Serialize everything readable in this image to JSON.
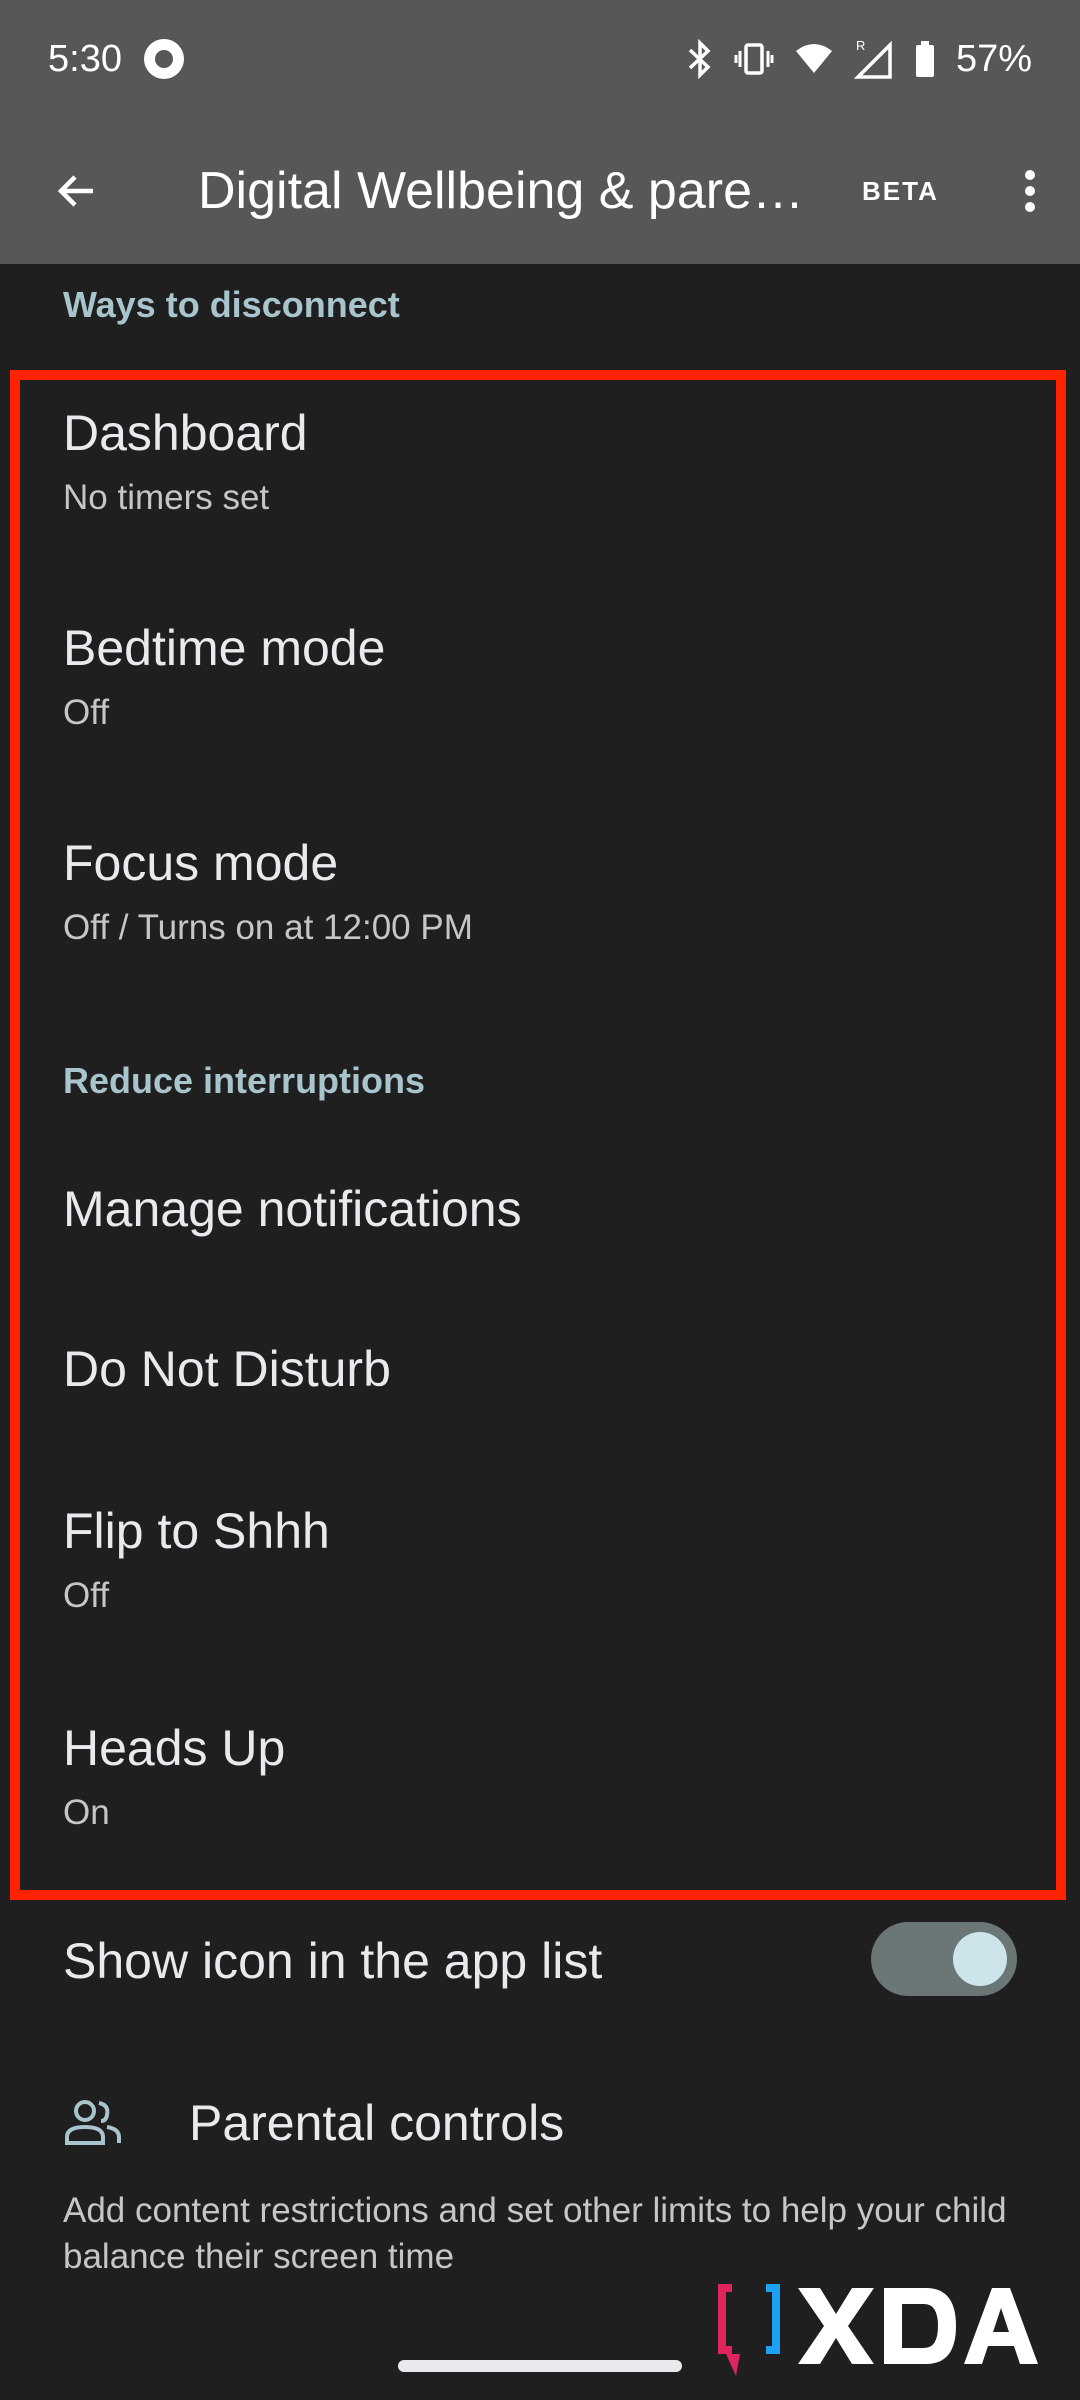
{
  "status_bar": {
    "time": "5:30",
    "battery": "57%"
  },
  "app_bar": {
    "title": "Digital Wellbeing & paren…",
    "badge": "BETA"
  },
  "sections": {
    "ways_to_disconnect": "Ways to disconnect",
    "reduce_interruptions": "Reduce interruptions"
  },
  "items": {
    "dashboard": {
      "title": "Dashboard",
      "subtitle": "No timers set"
    },
    "bedtime": {
      "title": "Bedtime mode",
      "subtitle": "Off"
    },
    "focus": {
      "title": "Focus mode",
      "subtitle": "Off / Turns on at 12:00 PM"
    },
    "notifications": {
      "title": "Manage notifications"
    },
    "dnd": {
      "title": "Do Not Disturb"
    },
    "flip": {
      "title": "Flip to Shhh",
      "subtitle": "Off"
    },
    "heads_up": {
      "title": "Heads Up",
      "subtitle": "On"
    },
    "show_icon": {
      "title": "Show icon in the app list",
      "toggle_on": true
    },
    "parental": {
      "title": "Parental controls",
      "description": "Add content restrictions and set other limits to help your child balance their screen time"
    }
  },
  "watermark": {
    "text": "XDA"
  },
  "colors": {
    "bar_bg": "#575757",
    "page_bg": "#1f1f1f",
    "highlight": "#ff2200",
    "section_header": "#a8c4cc",
    "toggle_track": "#6b7677",
    "toggle_knob": "#cde4ea"
  }
}
